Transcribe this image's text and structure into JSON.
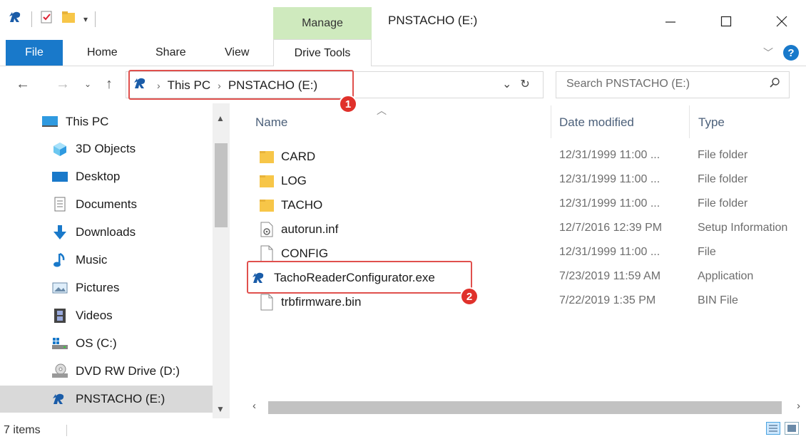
{
  "window": {
    "title": "PNSTACHO (E:)",
    "context_tab": "Manage"
  },
  "ribbon": {
    "tabs": [
      "File",
      "Home",
      "Share",
      "View",
      "Drive Tools"
    ]
  },
  "address": {
    "crumbs": [
      "This PC",
      "PNSTACHO (E:)"
    ],
    "search_placeholder": "Search PNSTACHO (E:)"
  },
  "badges": [
    "1",
    "2"
  ],
  "nav": {
    "items": [
      {
        "label": "This PC",
        "icon": "monitor-icon"
      },
      {
        "label": "3D Objects",
        "icon": "3d-objects-icon"
      },
      {
        "label": "Desktop",
        "icon": "desktop-icon"
      },
      {
        "label": "Documents",
        "icon": "documents-icon"
      },
      {
        "label": "Downloads",
        "icon": "download-arrow-icon"
      },
      {
        "label": "Music",
        "icon": "music-note-icon"
      },
      {
        "label": "Pictures",
        "icon": "pictures-icon"
      },
      {
        "label": "Videos",
        "icon": "film-icon"
      },
      {
        "label": "OS (C:)",
        "icon": "windows-drive-icon"
      },
      {
        "label": "DVD RW Drive (D:)",
        "icon": "dvd-drive-icon"
      },
      {
        "label": "PNSTACHO (E:)",
        "icon": "pnstacho-logo-icon"
      }
    ],
    "selected": "PNSTACHO (E:)"
  },
  "columns": {
    "name": "Name",
    "date": "Date modified",
    "type": "Type"
  },
  "files": [
    {
      "name": "CARD",
      "date": "12/31/1999 11:00 ...",
      "type": "File folder",
      "icon": "folder-icon"
    },
    {
      "name": "LOG",
      "date": "12/31/1999 11:00 ...",
      "type": "File folder",
      "icon": "folder-icon"
    },
    {
      "name": "TACHO",
      "date": "12/31/1999 11:00 ...",
      "type": "File folder",
      "icon": "folder-icon"
    },
    {
      "name": "autorun.inf",
      "date": "12/7/2016 12:39 PM",
      "type": "Setup Information",
      "icon": "settings-file-icon"
    },
    {
      "name": "CONFIG",
      "date": "12/31/1999 11:00 ...",
      "type": "File",
      "icon": "blank-file-icon"
    },
    {
      "name": "TachoReaderConfigurator.exe",
      "date": "7/23/2019 11:59 AM",
      "type": "Application",
      "icon": "pnstacho-logo-icon"
    },
    {
      "name": "trbfirmware.bin",
      "date": "7/22/2019 1:35 PM",
      "type": "BIN File",
      "icon": "blank-file-icon"
    }
  ],
  "status": {
    "count": "7 items"
  },
  "colors": {
    "accent": "#1979ca",
    "manage_tab": "#cfeabe",
    "highlight": "#e0504d",
    "badge": "#e0312b"
  }
}
